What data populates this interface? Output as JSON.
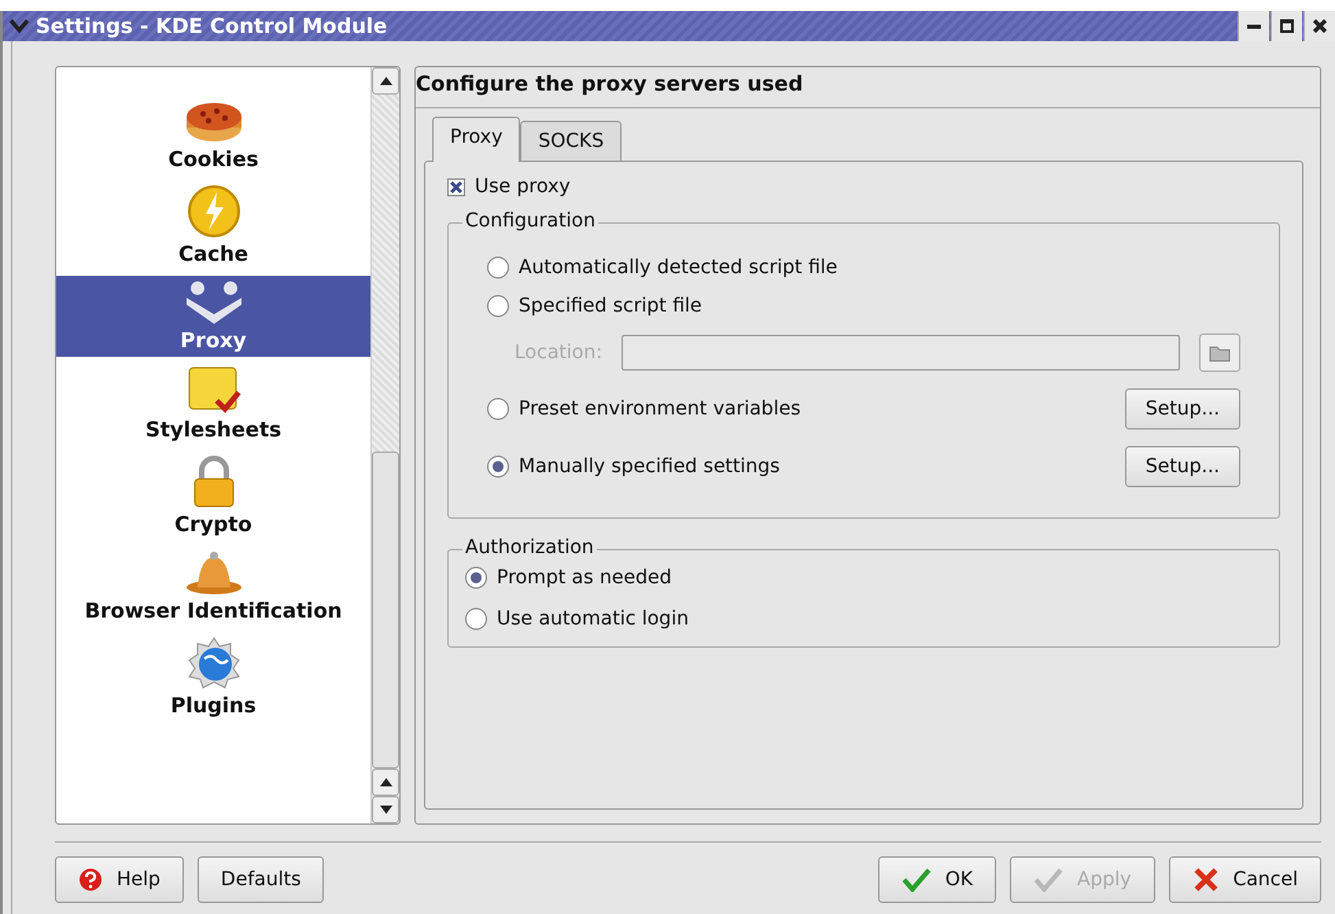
{
  "window": {
    "title": "Settings - KDE Control Module"
  },
  "sidebar": {
    "items": [
      {
        "label": "Cookies",
        "kind": "cookie",
        "selected": false
      },
      {
        "label": "Cache",
        "kind": "cache",
        "selected": false
      },
      {
        "label": "Proxy",
        "kind": "proxy",
        "selected": true
      },
      {
        "label": "Stylesheets",
        "kind": "css",
        "selected": false
      },
      {
        "label": "Crypto",
        "kind": "crypto",
        "selected": false
      },
      {
        "label": "Browser Identification",
        "kind": "identity",
        "selected": false
      },
      {
        "label": "Plugins",
        "kind": "plugin",
        "selected": false
      }
    ]
  },
  "heading": "Configure the proxy servers used",
  "tabs": [
    {
      "label": "Proxy",
      "selected": true
    },
    {
      "label": "SOCKS",
      "selected": false
    }
  ],
  "use_proxy": {
    "label": "Use proxy",
    "checked": true
  },
  "configuration": {
    "title": "Configuration",
    "rows": [
      {
        "kind": "radio",
        "label": "Automatically detected script file",
        "selected": false
      },
      {
        "kind": "radio",
        "label": "Specified script file",
        "selected": false
      },
      {
        "kind": "location",
        "label": "Location:",
        "disabled": true
      },
      {
        "kind": "radio",
        "label": "Preset environment variables",
        "selected": false,
        "button": "Setup..."
      },
      {
        "kind": "radio",
        "label": "Manually specified settings",
        "selected": true,
        "button": "Setup..."
      }
    ]
  },
  "authorization": {
    "title": "Authorization",
    "options": [
      {
        "label": "Prompt as needed",
        "selected": true
      },
      {
        "label": "Use automatic login",
        "selected": false
      }
    ]
  },
  "buttons_left": [
    {
      "label": "Help",
      "kind": "help",
      "disabled": false
    },
    {
      "label": "Defaults",
      "kind": "plain",
      "disabled": false
    }
  ],
  "buttons_right": [
    {
      "label": "OK",
      "kind": "accept",
      "disabled": false
    },
    {
      "label": "Apply",
      "kind": "accept",
      "disabled": true
    },
    {
      "label": "Cancel",
      "kind": "reject",
      "disabled": false
    }
  ]
}
